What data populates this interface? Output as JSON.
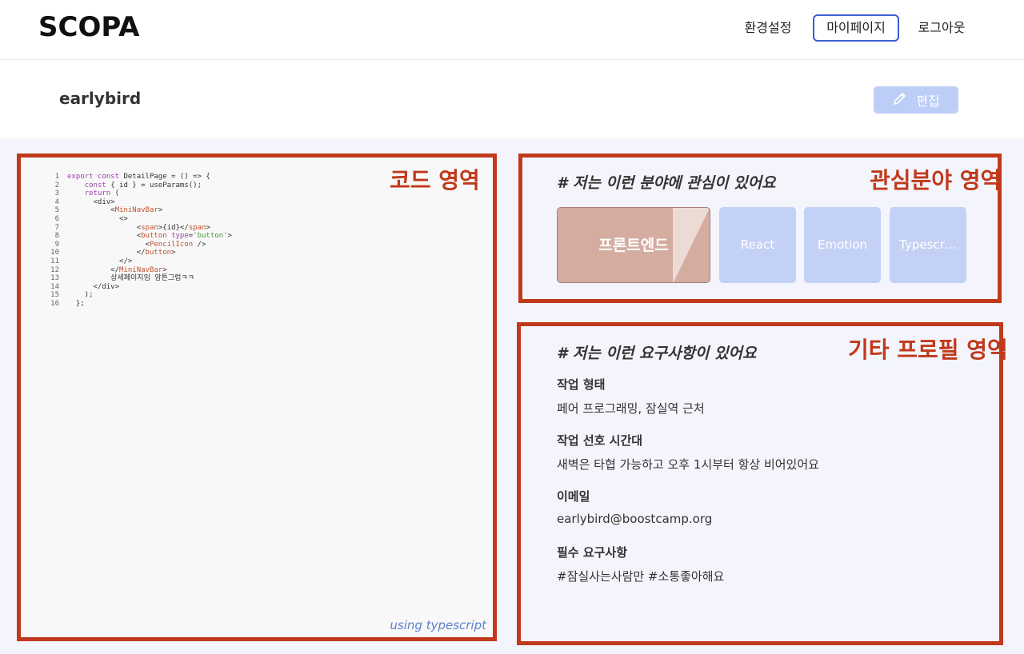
{
  "header": {
    "logo": "SCOPA",
    "nav": {
      "settings": "환경설정",
      "mypage": "마이페이지",
      "logout": "로그아웃"
    }
  },
  "profile": {
    "username": "earlybird",
    "edit_label": "편집"
  },
  "annotations": {
    "code": "코드 영역",
    "interest": "관심분야 영역",
    "other": "기타 프로필 영역"
  },
  "code_panel": {
    "lines": [
      {
        "n": "1",
        "text": "export const DetailPage = () => {"
      },
      {
        "n": "2",
        "text": "    const { id } = useParams();"
      },
      {
        "n": "3",
        "text": "    return ("
      },
      {
        "n": "4",
        "text": "      <div>"
      },
      {
        "n": "5",
        "text": "          <MiniNavBar>"
      },
      {
        "n": "6",
        "text": "            <>"
      },
      {
        "n": "7",
        "text": "                <span>{id}</span>"
      },
      {
        "n": "8",
        "text": "                <button type='button'>"
      },
      {
        "n": "9",
        "text": "                  <PencilIcon />"
      },
      {
        "n": "10",
        "text": "                </button>"
      },
      {
        "n": "11",
        "text": "            </>"
      },
      {
        "n": "12",
        "text": "          </MiniNavBar>"
      },
      {
        "n": "13",
        "text": "          상세페이지임 암튼그럼ㅋㅋ"
      },
      {
        "n": "14",
        "text": "      </div>"
      },
      {
        "n": "15",
        "text": "    );"
      },
      {
        "n": "16",
        "text": "  };"
      }
    ],
    "language_note": "using typescript"
  },
  "interests": {
    "title": "#  저는 이런 분야에 관심이 있어요",
    "tags": [
      "프론트엔드",
      "React",
      "Emotion",
      "Typescr…"
    ]
  },
  "other_profile": {
    "title": "#  저는 이런 요구사항이 있어요",
    "fields": [
      {
        "label": "작업 형태",
        "value": "페어 프로그래밍, 잠실역 근처"
      },
      {
        "label": "작업 선호 시간대",
        "value": "새벽은 타협 가능하고 오후 1시부터 항상 비어있어요"
      },
      {
        "label": "이메일",
        "value": "earlybird@boostcamp.org"
      },
      {
        "label": "필수 요구사항",
        "value": "#잠실사는사람만 #소통좋아해요"
      }
    ]
  },
  "colors": {
    "accent_blue": "#3c5fd0",
    "annotation_red": "#c0391b",
    "tag_primary": "#d4ada0",
    "tag_secondary": "#c4d1f6"
  }
}
